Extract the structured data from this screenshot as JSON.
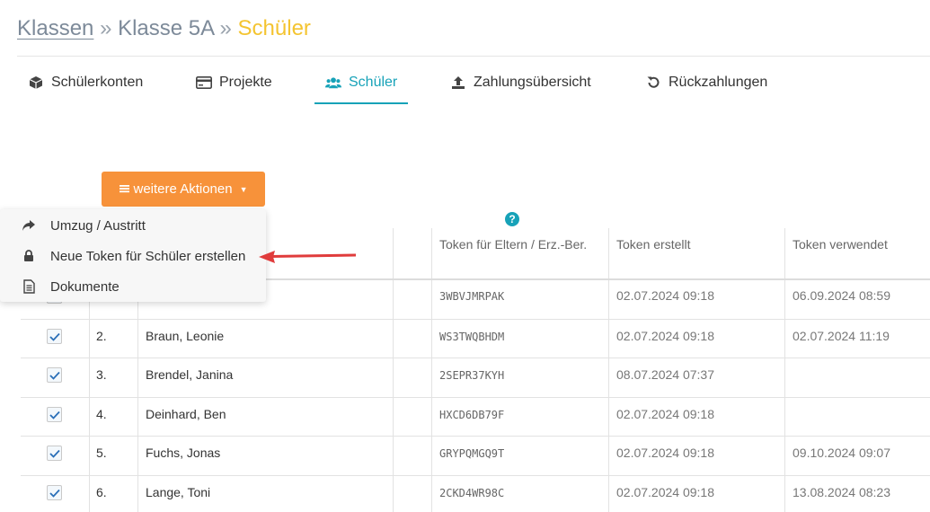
{
  "breadcrumb": {
    "root": "Klassen",
    "sep1": "»",
    "class": "Klasse 5A",
    "sep2": "»",
    "current": "Schüler"
  },
  "tabs": [
    {
      "label": "Schülerkonten",
      "icon": "cube-icon"
    },
    {
      "label": "Projekte",
      "icon": "credit-card-icon"
    },
    {
      "label": "Schüler",
      "icon": "users-icon",
      "active": true
    },
    {
      "label": "Zahlungsübersicht",
      "icon": "upload-icon"
    },
    {
      "label": "Rückzahlungen",
      "icon": "undo-icon"
    }
  ],
  "actions": {
    "label": "weitere Aktionen"
  },
  "dropdown": [
    {
      "label": "Umzug / Austritt",
      "icon": "share-arrow-icon"
    },
    {
      "label": "Neue Token für Schüler erstellen",
      "icon": "lock-icon"
    },
    {
      "label": "Dokumente",
      "icon": "document-icon"
    }
  ],
  "table": {
    "headers": {
      "token_parent": "Token für Eltern / Erz.-Ber.",
      "token_created": "Token erstellt",
      "token_used": "Token verwendet"
    },
    "rows": [
      {
        "num": "",
        "name": "",
        "token": "3WBVJMRPAK",
        "created": "02.07.2024 09:18",
        "used": "06.09.2024 08:59"
      },
      {
        "num": "2.",
        "name": "Braun, Leonie",
        "token": "WS3TWQBHDM",
        "created": "02.07.2024 09:18",
        "used": "02.07.2024 11:19"
      },
      {
        "num": "3.",
        "name": "Brendel, Janina",
        "token": "2SEPR37KYH",
        "created": "08.07.2024 07:37",
        "used": ""
      },
      {
        "num": "4.",
        "name": "Deinhard, Ben",
        "token": "HXCD6DB79F",
        "created": "02.07.2024 09:18",
        "used": ""
      },
      {
        "num": "5.",
        "name": "Fuchs, Jonas",
        "token": "GRYPQMGQ9T",
        "created": "02.07.2024 09:18",
        "used": "09.10.2024 09:07"
      },
      {
        "num": "6.",
        "name": "Lange, Toni",
        "token": "2CKD4WR98C",
        "created": "02.07.2024 09:18",
        "used": "13.08.2024 08:23"
      }
    ]
  },
  "colors": {
    "accent": "#17a2b8",
    "button": "#f7923a",
    "current": "#f4c430",
    "arrow": "#e03c3c"
  }
}
